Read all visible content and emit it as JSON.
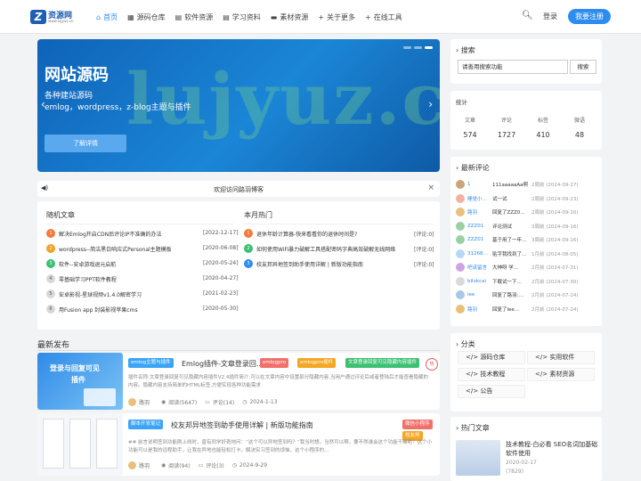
{
  "header": {
    "logo_title": "资源网",
    "logo_sub": "www.lujyuz.cn",
    "nav": [
      {
        "icon": "home-icon",
        "glyph": "⌂",
        "label": "首页",
        "active": true
      },
      {
        "icon": "grid-icon",
        "glyph": "▦",
        "label": "源码仓库"
      },
      {
        "icon": "file-icon",
        "glyph": "▤",
        "label": "软件资源"
      },
      {
        "icon": "doc-icon",
        "glyph": "▤",
        "label": "学习资料"
      },
      {
        "icon": "folder-icon",
        "glyph": "▬",
        "label": "素材资源"
      },
      {
        "icon": "plus-icon",
        "glyph": "+",
        "label": "关于更多"
      },
      {
        "icon": "plus-icon",
        "glyph": "+",
        "label": "在线工具"
      }
    ],
    "login": "登录",
    "register": "我要注册"
  },
  "banner": {
    "watermark": "lujyuz.cn",
    "title": "网站源码",
    "sub1": "各种建站源码",
    "sub2": "emlog，wordpress，z-blog主题与插件",
    "button": "了解详情"
  },
  "notice": {
    "text": "欢迎访问路羽博客"
  },
  "random": {
    "title": "随机文章",
    "items": [
      {
        "n": "1",
        "color": "#f5793b",
        "text": "解决Emlog开启CDN后评论IP不准确的办法",
        "date": "[2022-12-17]"
      },
      {
        "n": "2",
        "color": "#f0a22e",
        "text": "wordpress--简洁黑白响应式Personal主题模板",
        "date": "[2020-06-08]"
      },
      {
        "n": "3",
        "color": "#3cc072",
        "text": "软件--安卓游戏退元启航",
        "date": "[2020-05-24]"
      },
      {
        "n": "4",
        "color": "#d8d8d8",
        "text": "零基础学习PPT软件教程",
        "date": "[2020-04-27]"
      },
      {
        "n": "5",
        "color": "#d8d8d8",
        "text": "安卓影视-星球视频v1.4.0解密学习",
        "date": "[2021-02-23]"
      },
      {
        "n": "6",
        "color": "#d8d8d8",
        "text": "用Fusion app 封装影视苹果cms",
        "date": "[2020-05-30]"
      }
    ]
  },
  "hot": {
    "title": "本月热门",
    "items": [
      {
        "n": "1",
        "color": "#f5793b",
        "text": "退休年龄计算器-快来看看你的退休时间是?",
        "tag": "[评论:0]"
      },
      {
        "n": "2",
        "color": "#3cc072",
        "text": "如何使用WiFi暴力破解工具搭配密码字典高效破解无线网络",
        "tag": "[评论:0]"
      },
      {
        "n": "3",
        "color": "#2d8cf0",
        "text": "校友邦异地签到助手使用详解 | 新版功能指南",
        "tag": "[评论:0]"
      }
    ]
  },
  "latest": {
    "title": "最新发布",
    "posts": [
      {
        "category": "emlog主题与插件",
        "title": "Emlog插件-文章登录回…",
        "tags": [
          "emlogpro",
          "emlogpro插件",
          "文章登录回复可见隐藏内容插件"
        ],
        "excerpt": "插件名称:文章登录回复可见隐藏内容插件V2.4插件简介:可以在文章内容中设置部分隐藏内容,当用户通过评论后或者登陆后才能查看隐藏的内容。隐藏内容支持简单的HTML标签,方便实现各种功能需求",
        "author": "路羽",
        "views": "阅读(5647)",
        "comments": "评论(14)",
        "date": "2024-1-13",
        "thumb_line1": "登录与回复可见",
        "thumb_line2": "插件"
      },
      {
        "category": "脚本开发笔记",
        "title": "校友邦异地签到助手使用详解 | 新版功能指南",
        "tags": [
          "微信小程序",
          "校友邦"
        ],
        "excerpt": "## 前言说明签到功能刚上线时，曾有同学好奇地问：“这个可以异地签到吗？”我当时想，当然可以啊，要不然谁会这个功能干嘛呢？这个小功能可以是我的远程助手，让我在异地也能轻松打卡。解决实习签到的烦恼，这个小程序的...",
        "author": "路羽",
        "views": "阅读(94)",
        "comments": "评论(3)",
        "date": "2024-9-29"
      }
    ]
  },
  "search": {
    "title": "搜索",
    "placeholder": "请善用搜索功能",
    "button": "搜索"
  },
  "stats": {
    "title": "统计",
    "items": [
      {
        "label": "文章",
        "value": "574"
      },
      {
        "label": "评论",
        "value": "1727"
      },
      {
        "label": "标签",
        "value": "410"
      },
      {
        "label": "微语",
        "value": "48"
      }
    ]
  },
  "comments": {
    "title": "最新评论",
    "items": [
      {
        "name": "1",
        "text": "111aaaaaAa啊",
        "time": "2周前 (2024-09-27)",
        "color": "#c9a57a"
      },
      {
        "name": "睡觉小新…",
        "text": "试一试",
        "time": "2周前 (2024-09-23)",
        "color": "#f3b2a0"
      },
      {
        "name": "路羽",
        "text": "回复了ZZZ01…",
        "time": "2周前 (2024-09-16)",
        "color": "#e9c07a"
      },
      {
        "name": "ZZZ01",
        "text": "评论测试",
        "time": "3周前 (2024-09-16)",
        "color": "#9ad0a4"
      },
      {
        "name": "ZZZ01",
        "text": "基于用了一年…",
        "time": "3周前 (2024-09-16)",
        "color": "#9ad0a4"
      },
      {
        "name": "3126808313",
        "text": "贴字我找到了…",
        "time": "1月前 (2024-08-05)",
        "color": "#b7d7f5"
      },
      {
        "name": "吧该留言",
        "text": "大神呀 学…",
        "time": "2月前 (2024-07-31)",
        "color": "#cfa4e0"
      },
      {
        "name": "bilokcai",
        "text": "下载试一下…",
        "time": "2月前 (2024-07-30)",
        "color": "#d9d9d9"
      },
      {
        "name": "lee",
        "text": "回复了路羽:…",
        "time": "2月前 (2024-07-24)",
        "color": "#a7c8e6"
      },
      {
        "name": "路羽",
        "text": "回复了lee…",
        "time": "2月前 (2024-07-24)",
        "color": "#e9c07a"
      }
    ]
  },
  "categories": {
    "title": "分类",
    "items": [
      {
        "icon": "code-icon",
        "label": "源码仓库"
      },
      {
        "icon": "code-icon",
        "label": "实用软件"
      },
      {
        "icon": "code-icon",
        "label": "技术教程"
      },
      {
        "icon": "code-icon",
        "label": "素材资源"
      },
      {
        "icon": "code-icon",
        "label": "公告"
      }
    ]
  },
  "hot_articles": {
    "title": "热门文章",
    "item_title": "技术教程-白必看 SEO名词加基础软件使用",
    "item_date": "2020-02-17",
    "item_views": "(7829)"
  },
  "colors": {
    "accent": "#2d8cf0",
    "banner": "#1b86d6"
  }
}
